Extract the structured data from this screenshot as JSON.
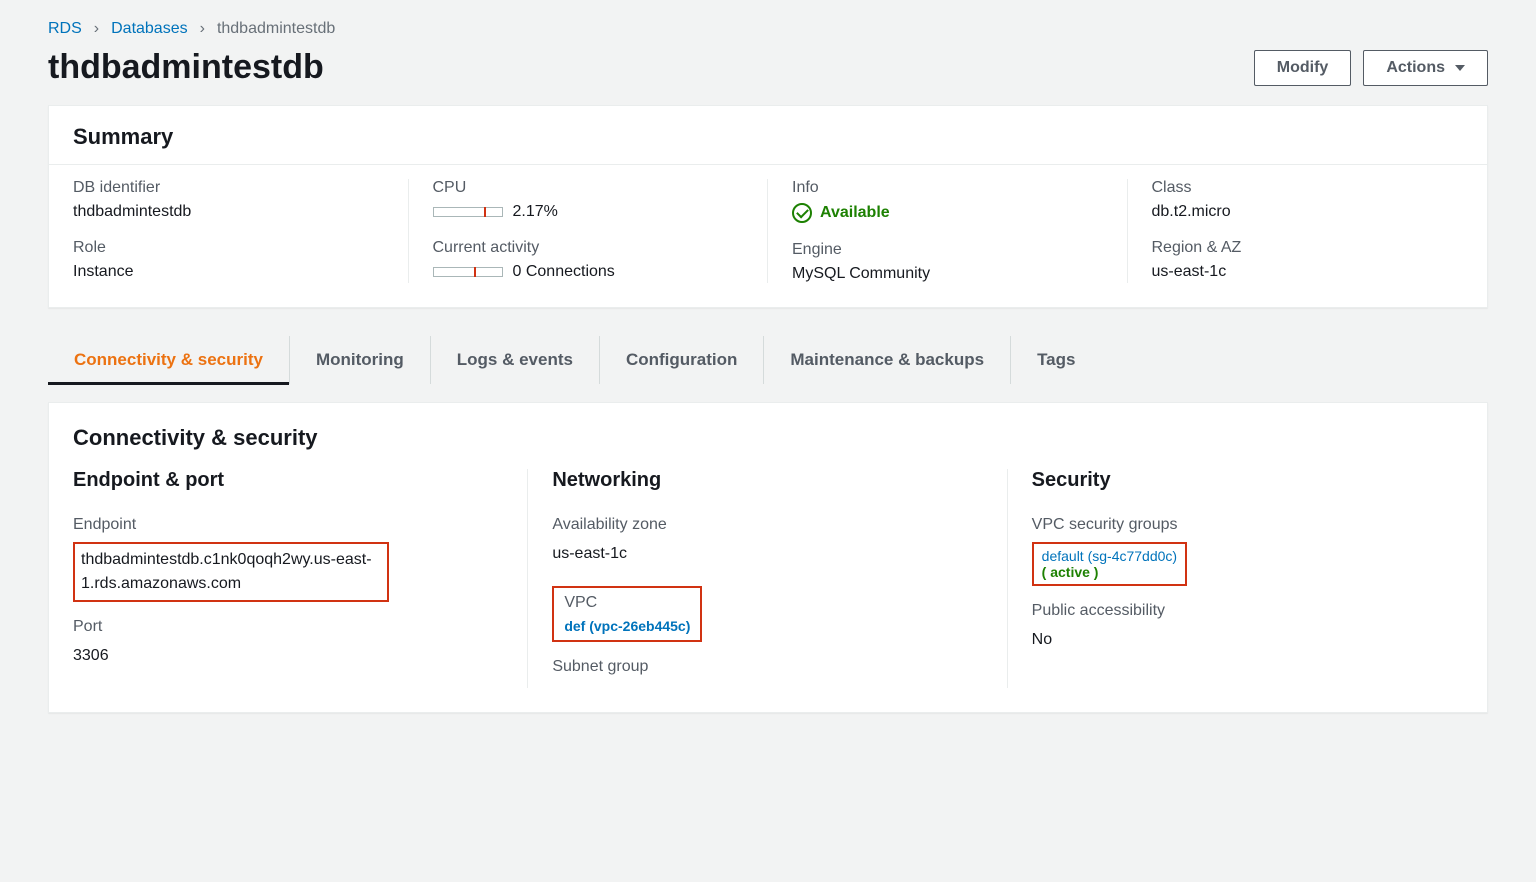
{
  "breadcrumb": {
    "root": "RDS",
    "parent": "Databases",
    "current": "thdbadmintestdb"
  },
  "pageTitle": "thdbadmintestdb",
  "buttons": {
    "modify": "Modify",
    "actions": "Actions"
  },
  "summary": {
    "title": "Summary",
    "dbIdentifier": {
      "label": "DB identifier",
      "value": "thdbadmintestdb"
    },
    "role": {
      "label": "Role",
      "value": "Instance"
    },
    "cpu": {
      "label": "CPU",
      "value": "2.17%",
      "percent": 2.17
    },
    "currentActivity": {
      "label": "Current activity",
      "value": "0 Connections",
      "percent": 0
    },
    "info": {
      "label": "Info",
      "value": "Available"
    },
    "engine": {
      "label": "Engine",
      "value": "MySQL Community"
    },
    "class": {
      "label": "Class",
      "value": "db.t2.micro"
    },
    "regionAZ": {
      "label": "Region & AZ",
      "value": "us-east-1c"
    }
  },
  "tabs": [
    "Connectivity & security",
    "Monitoring",
    "Logs & events",
    "Configuration",
    "Maintenance & backups",
    "Tags"
  ],
  "connSec": {
    "title": "Connectivity & security",
    "endpointPort": {
      "title": "Endpoint & port",
      "endpointLabel": "Endpoint",
      "endpointValue": "thdbadmintestdb.c1nk0qoqh2wy.us-east-1.rds.amazonaws.com",
      "portLabel": "Port",
      "portValue": "3306"
    },
    "networking": {
      "title": "Networking",
      "azLabel": "Availability zone",
      "azValue": "us-east-1c",
      "vpcLabel": "VPC",
      "vpcValue": "def (vpc-26eb445c)",
      "subnetLabel": "Subnet group"
    },
    "security": {
      "title": "Security",
      "sgLabel": "VPC security groups",
      "sgValue": "default (sg-4c77dd0c)",
      "sgStatus": "( active )",
      "paLabel": "Public accessibility",
      "paValue": "No"
    }
  }
}
